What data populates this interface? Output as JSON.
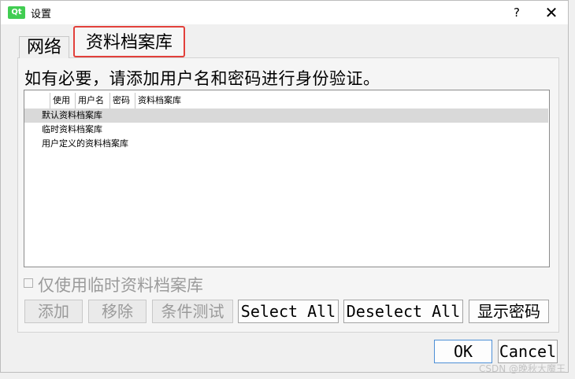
{
  "window": {
    "title": "设置",
    "app_icon": "Qt",
    "help": "?",
    "close": "✕"
  },
  "tabs": [
    {
      "label": "网络"
    },
    {
      "label": "资料档案库"
    }
  ],
  "hint": "如有必要，请添加用户名和密码进行身份验证。",
  "table": {
    "columns": [
      "使用",
      "用户名",
      "密码",
      "资料档案库"
    ],
    "rows": [
      "默认资料档案库",
      "临时资料档案库",
      "用户定义的资料档案库"
    ]
  },
  "temp_only_checkbox": {
    "label": "仅使用临时资料档案库",
    "checked": false
  },
  "buttons": {
    "add": "添加",
    "remove": "移除",
    "test": "条件测试",
    "select_all": "Select All",
    "deselect_all": "Deselect All",
    "show_password": "显示密码"
  },
  "footer": {
    "ok": "OK",
    "cancel": "Cancel"
  },
  "watermark": "CSDN @晚秋大魔王"
}
